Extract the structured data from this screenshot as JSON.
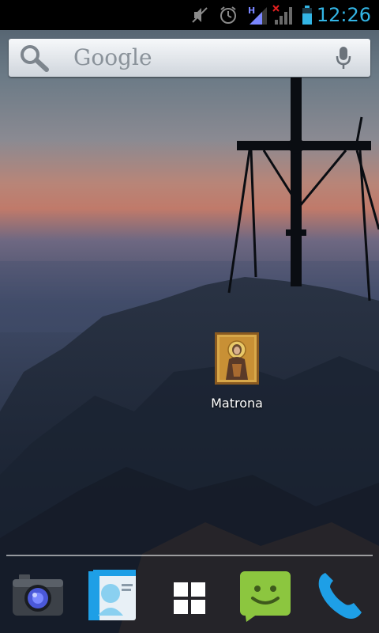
{
  "status_bar": {
    "time": "12:26",
    "network_label": "H",
    "icons": [
      "sound-muted-icon",
      "alarm-icon",
      "mobile-data-signal-icon",
      "no-signal-icon",
      "battery-icon"
    ]
  },
  "search": {
    "label": "Google",
    "icons": [
      "search-icon",
      "mic-icon"
    ]
  },
  "home_screen": {
    "apps": [
      {
        "label": "Matrona",
        "icon": "icon-app"
      }
    ]
  },
  "dock": {
    "items": [
      "camera-icon",
      "contacts-icon",
      "app-drawer-icon",
      "messaging-icon",
      "phone-icon"
    ]
  },
  "colors": {
    "clock": "#33b5e5",
    "status_bar": "#000000",
    "messaging_green": "#8cc63f",
    "phone_blue": "#1e9fe6"
  }
}
